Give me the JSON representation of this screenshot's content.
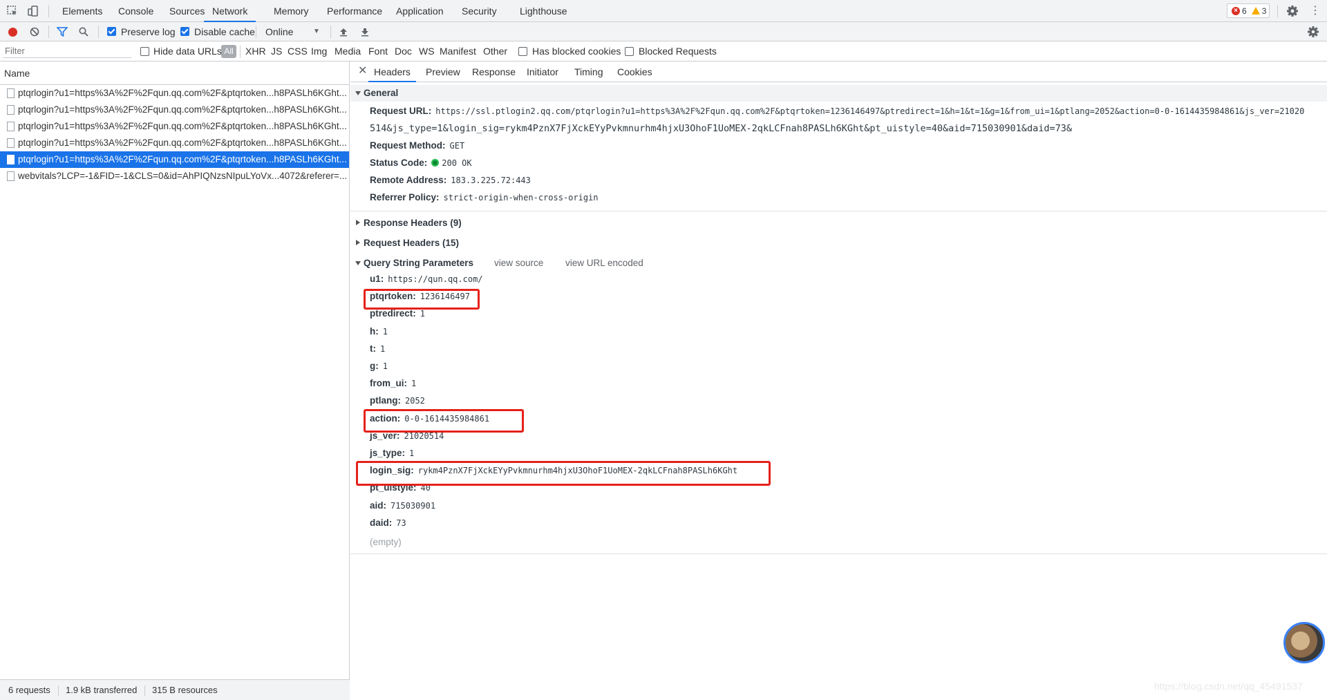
{
  "top_tabs": [
    "Elements",
    "Console",
    "Sources",
    "Network",
    "Memory",
    "Performance",
    "Application",
    "Security",
    "Lighthouse"
  ],
  "active_top_tab": "Network",
  "badges": {
    "errors": "6",
    "warnings": "3"
  },
  "toolbar": {
    "preserve_log": "Preserve log",
    "disable_cache": "Disable cache",
    "throttle": "Online"
  },
  "filter": {
    "placeholder": "Filter",
    "hide_data_urls": "Hide data URLs",
    "types": [
      "All",
      "XHR",
      "JS",
      "CSS",
      "Img",
      "Media",
      "Font",
      "Doc",
      "WS",
      "Manifest",
      "Other"
    ],
    "has_blocked_cookies": "Has blocked cookies",
    "blocked_requests": "Blocked Requests"
  },
  "requests": {
    "column": "Name",
    "rows": [
      "ptqrlogin?u1=https%3A%2F%2Fqun.qq.com%2F&ptqrtoken...h8PASLh6KGht...",
      "ptqrlogin?u1=https%3A%2F%2Fqun.qq.com%2F&ptqrtoken...h8PASLh6KGht...",
      "ptqrlogin?u1=https%3A%2F%2Fqun.qq.com%2F&ptqrtoken...h8PASLh6KGht...",
      "ptqrlogin?u1=https%3A%2F%2Fqun.qq.com%2F&ptqrtoken...h8PASLh6KGht...",
      "ptqrlogin?u1=https%3A%2F%2Fqun.qq.com%2F&ptqrtoken...h8PASLh6KGht...",
      "webvitals?LCP=-1&FID=-1&CLS=0&id=AhPIQNzsNIpuLYoVx...4072&referer=..."
    ],
    "selected_index": 4
  },
  "status_bar": {
    "requests": "6 requests",
    "transferred": "1.9 kB transferred",
    "resources": "315 B resources"
  },
  "detail_tabs": [
    "Headers",
    "Preview",
    "Response",
    "Initiator",
    "Timing",
    "Cookies"
  ],
  "active_detail_tab": "Headers",
  "general": {
    "title": "General",
    "request_url_key": "Request URL:",
    "request_url_line1": "https://ssl.ptlogin2.qq.com/ptqrlogin?u1=https%3A%2F%2Fqun.qq.com%2F&ptqrtoken=1236146497&ptredirect=1&h=1&t=1&g=1&from_ui=1&ptlang=2052&action=0-0-1614435984861&js_ver=21020",
    "request_url_line2": "514&js_type=1&login_sig=rykm4PznX7FjXckEYyPvkmnurhm4hjxU3OhoF1UoMEX-2qkLCFnah8PASLh6KGht&pt_uistyle=40&aid=715030901&daid=73&",
    "method_key": "Request Method:",
    "method": "GET",
    "status_key": "Status Code:",
    "status": "200 OK",
    "remote_key": "Remote Address:",
    "remote": "183.3.225.72:443",
    "referrer_key": "Referrer Policy:",
    "referrer": "strict-origin-when-cross-origin"
  },
  "response_headers": "Response Headers (9)",
  "request_headers": "Request Headers (15)",
  "query": {
    "title": "Query String Parameters",
    "view_source": "view source",
    "view_url_encoded": "view URL encoded",
    "params": [
      {
        "k": "u1:",
        "v": "https://qun.qq.com/"
      },
      {
        "k": "ptqrtoken:",
        "v": "1236146497"
      },
      {
        "k": "ptredirect:",
        "v": "1"
      },
      {
        "k": "h:",
        "v": "1"
      },
      {
        "k": "t:",
        "v": "1"
      },
      {
        "k": "g:",
        "v": "1"
      },
      {
        "k": "from_ui:",
        "v": "1"
      },
      {
        "k": "ptlang:",
        "v": "2052"
      },
      {
        "k": "action:",
        "v": "0-0-1614435984861"
      },
      {
        "k": "js_ver:",
        "v": "21020514"
      },
      {
        "k": "js_type:",
        "v": "1"
      },
      {
        "k": "login_sig:",
        "v": "rykm4PznX7FjXckEYyPvkmnurhm4hjxU3OhoF1UoMEX-2qkLCFnah8PASLh6KGht"
      },
      {
        "k": "pt_uistyle:",
        "v": "40"
      },
      {
        "k": "aid:",
        "v": "715030901"
      },
      {
        "k": "daid:",
        "v": "73"
      }
    ],
    "empty": "(empty)"
  },
  "watermark": "https://blog.csdn.net/qq_45491537",
  "colors": {
    "accent": "#1a73e8",
    "highlight": "#e5211b",
    "status_ok": "#0a8a2f"
  }
}
